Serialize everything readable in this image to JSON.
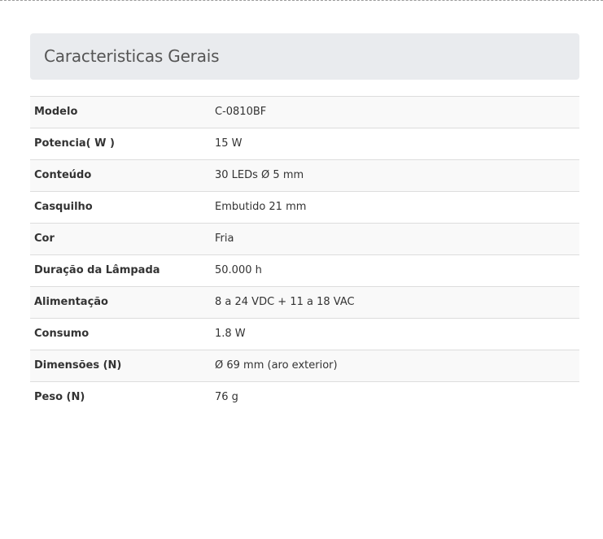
{
  "panel": {
    "title": "Caracteristicas Gerais"
  },
  "specs": [
    {
      "label": "Modelo",
      "value": "C-0810BF"
    },
    {
      "label": "Potencia( W )",
      "value": "15 W"
    },
    {
      "label": "Conteúdo",
      "value": "30 LEDs Ø 5 mm"
    },
    {
      "label": "Casquilho",
      "value": "Embutido 21 mm"
    },
    {
      "label": "Cor",
      "value": "Fria"
    },
    {
      "label": "Duração da Lâmpada",
      "value": "50.000 h"
    },
    {
      "label": "Alimentação",
      "value": "8 a 24 VDC + 11 a 18 VAC"
    },
    {
      "label": "Consumo",
      "value": "1.8 W"
    },
    {
      "label": "Dimensões (N)",
      "value": "Ø 69 mm (aro exterior)"
    },
    {
      "label": "Peso (N)",
      "value": "76 g"
    }
  ],
  "colors": {
    "header_bg": "#e9ebee",
    "row_stripe": "#f9f9f9",
    "border": "#dddddd",
    "text": "#333333"
  }
}
